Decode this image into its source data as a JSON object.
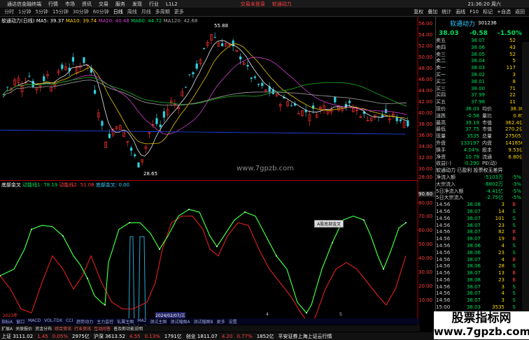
{
  "titlebar": {
    "app": "通达信金融终端",
    "menus": [
      "行情",
      "市场",
      "资讯",
      "交易",
      "服务",
      "发现",
      "行业",
      "L1L2"
    ],
    "trade_login": "交易未登录",
    "stock": "软通动力",
    "time": "21:36:20 周六"
  },
  "periods": [
    "分时",
    "1分钟",
    "5分钟",
    "15分钟",
    "30分钟",
    "60分钟",
    "日线",
    "周线",
    "月线",
    "多周期",
    "更多"
  ],
  "period_right": [
    "复权",
    "叠加",
    "统计",
    "画线",
    "F10",
    "标记",
    "+自选",
    "返回"
  ],
  "mainchart": {
    "title": "软通动力(日线)",
    "ma5": "MA5: 39.37",
    "ma10": "MA10: 39.74",
    "ma20": "MA20: 40.48",
    "ma60": "MA60: 44.72",
    "ma120": "MA120: 42.68",
    "high_label": "55.88",
    "low_label": "28.65",
    "site": "www.7gpzb.com",
    "date_left": "2023年",
    "date_cursor": "2024/02/07/三",
    "y_ticks": [
      "56.00",
      "54.00",
      "52.00",
      "50.00",
      "48.00",
      "46.00",
      "44.00",
      "42.00",
      "40.00",
      "38.00",
      "36.00",
      "34.00",
      "32.00",
      "30.00",
      "28.00"
    ]
  },
  "indicator": {
    "title": "底部金叉",
    "line1": "动能线1: 78.19",
    "line2": "动能线2: 51.08",
    "line3": "底部金叉: 0.00",
    "y_ticks": [
      "90.60",
      "80.00",
      "70.00",
      "60.00",
      "50.00",
      "40.00",
      "30.00",
      "20.00",
      "10.00"
    ],
    "tooltip": "A股底部金叉",
    "x_ticks": [
      "3",
      "4",
      "5"
    ]
  },
  "rpanel": {
    "name": "软通动力",
    "code": "301236",
    "price": "38.03",
    "change": "-0.58",
    "pct": "-1.50%",
    "sell": [
      {
        "label": "卖五",
        "price": "38.07",
        "vol": "52"
      },
      {
        "label": "卖四",
        "price": "38.06",
        "vol": "43"
      },
      {
        "label": "卖三",
        "price": "38.05",
        "vol": "52"
      },
      {
        "label": "卖二",
        "price": "38.04",
        "vol": "5"
      },
      {
        "label": "卖一",
        "price": "38.03",
        "vol": "117"
      }
    ],
    "buy": [
      {
        "label": "买一",
        "price": "38.02",
        "vol": "3"
      },
      {
        "label": "买二",
        "price": "38.01",
        "vol": "8"
      },
      {
        "label": "买三",
        "price": "38.00",
        "vol": "71"
      },
      {
        "label": "买四",
        "price": "37.99",
        "vol": "22"
      },
      {
        "label": "买五",
        "price": "37.98",
        "vol": "11"
      }
    ],
    "stats": [
      {
        "l1": "现价",
        "v1": "38.03",
        "l2": "均价",
        "v2": "38.30"
      },
      {
        "l1": "涨跌",
        "v1": "-0.58",
        "l2": "量比",
        "v2": "0.85"
      },
      {
        "l1": "最高",
        "v1": "39.19",
        "l2": "市值",
        "v2": "362.4亿"
      },
      {
        "l1": "最低",
        "v1": "37.75",
        "l2": "市值",
        "v2": "270.2亿"
      },
      {
        "l1": "现量",
        "v1": "3535",
        "l2": "总量",
        "v2": "275053"
      },
      {
        "l1": "外盘",
        "v1": "133197",
        "l2": "内盘",
        "v2": "141856"
      },
      {
        "l1": "换手",
        "v1": "4.04%",
        "l2": "股本",
        "v2": "9.53亿"
      },
      {
        "l1": "净资",
        "v1": "10.79",
        "l2": "流通",
        "v2": "6.80亿"
      },
      {
        "l1": "收益(-)",
        "v1": "-0.290",
        "l2": "PE(动)",
        "v2": ""
      }
    ],
    "note": "软通动力 已盈利 投票权无差异",
    "flows": [
      {
        "l": "净流入额",
        "v": "-5103万",
        "p": "-5%"
      },
      {
        "l": "大宗流入",
        "v": "-8802万",
        "p": "-3%"
      },
      {
        "l": "5日净流入额",
        "v": "-4.41亿",
        "p": "-5%"
      },
      {
        "l": "5日大宗流入",
        "v": "-2.75亿",
        "p": "-5%"
      }
    ],
    "ticks": [
      {
        "t": "14:56",
        "p": "38.08",
        "v": "3",
        "s": "B"
      },
      {
        "t": "14:56",
        "p": "38.07",
        "v": "14",
        "s": "S"
      },
      {
        "t": "14:56",
        "p": "38.07",
        "v": "101",
        "s": "S"
      },
      {
        "t": "14:56",
        "p": "38.07",
        "v": "23",
        "s": "S"
      },
      {
        "t": "14:56",
        "p": "38.07",
        "v": "82",
        "s": "B"
      },
      {
        "t": "14:56",
        "p": "38.07",
        "v": "19",
        "s": "B"
      },
      {
        "t": "14:56",
        "p": "38.06",
        "v": "4",
        "s": "S"
      },
      {
        "t": "14:56",
        "p": "38.06",
        "v": "23",
        "s": "S"
      },
      {
        "t": "14:56",
        "p": "38.07",
        "v": "4",
        "s": "B"
      },
      {
        "t": "14:56",
        "p": "38.06",
        "v": "28",
        "s": "S"
      },
      {
        "t": "14:56",
        "p": "38.07",
        "v": "13",
        "s": "B"
      },
      {
        "t": "14:56",
        "p": "38.08",
        "v": "23",
        "s": "B"
      },
      {
        "t": "14:56",
        "p": "38.07",
        "v": "3",
        "s": "S"
      },
      {
        "t": "14:56",
        "p": "38.07",
        "v": "4",
        "s": "S"
      },
      {
        "t": "14:56",
        "p": "38.07",
        "v": "3",
        "s": "S"
      },
      {
        "t": "15:00",
        "p": "38.03",
        "v": "3535",
        "s": "S"
      }
    ]
  },
  "tabrow": [
    "指标A",
    "窗口",
    "MACD",
    "VOL-TDX",
    "CCI",
    "趋势动力",
    "主力监控",
    "轧翼主图",
    "MA2",
    "测试主图",
    "测试幅图A",
    "测试幅图B",
    "更多",
    "设置"
  ],
  "bottomtabs": [
    "扩展A",
    "关联报价",
    "资金分布",
    "综合资讯",
    "行业资讯",
    "互动问答",
    "普及新功能说明"
  ],
  "statusbar": {
    "sh": "上证 3111.02",
    "sh_c": "1.45",
    "sh_p": "0.05%",
    "sh_v": "2975亿",
    "hs": "沪深 3613.52",
    "hs_c": "4.55",
    "hs_p": "0.13%",
    "hs_v": "1791亿",
    "cy": "创业 1811.07",
    "cy_c": "4.20",
    "cy_p": "0.77%",
    "cy_v": "1852亿",
    "msg": "平安证券上海上证云行情"
  },
  "watermark": {
    "t1": "股票指标网",
    "t2": "www.7gpzb.com"
  }
}
